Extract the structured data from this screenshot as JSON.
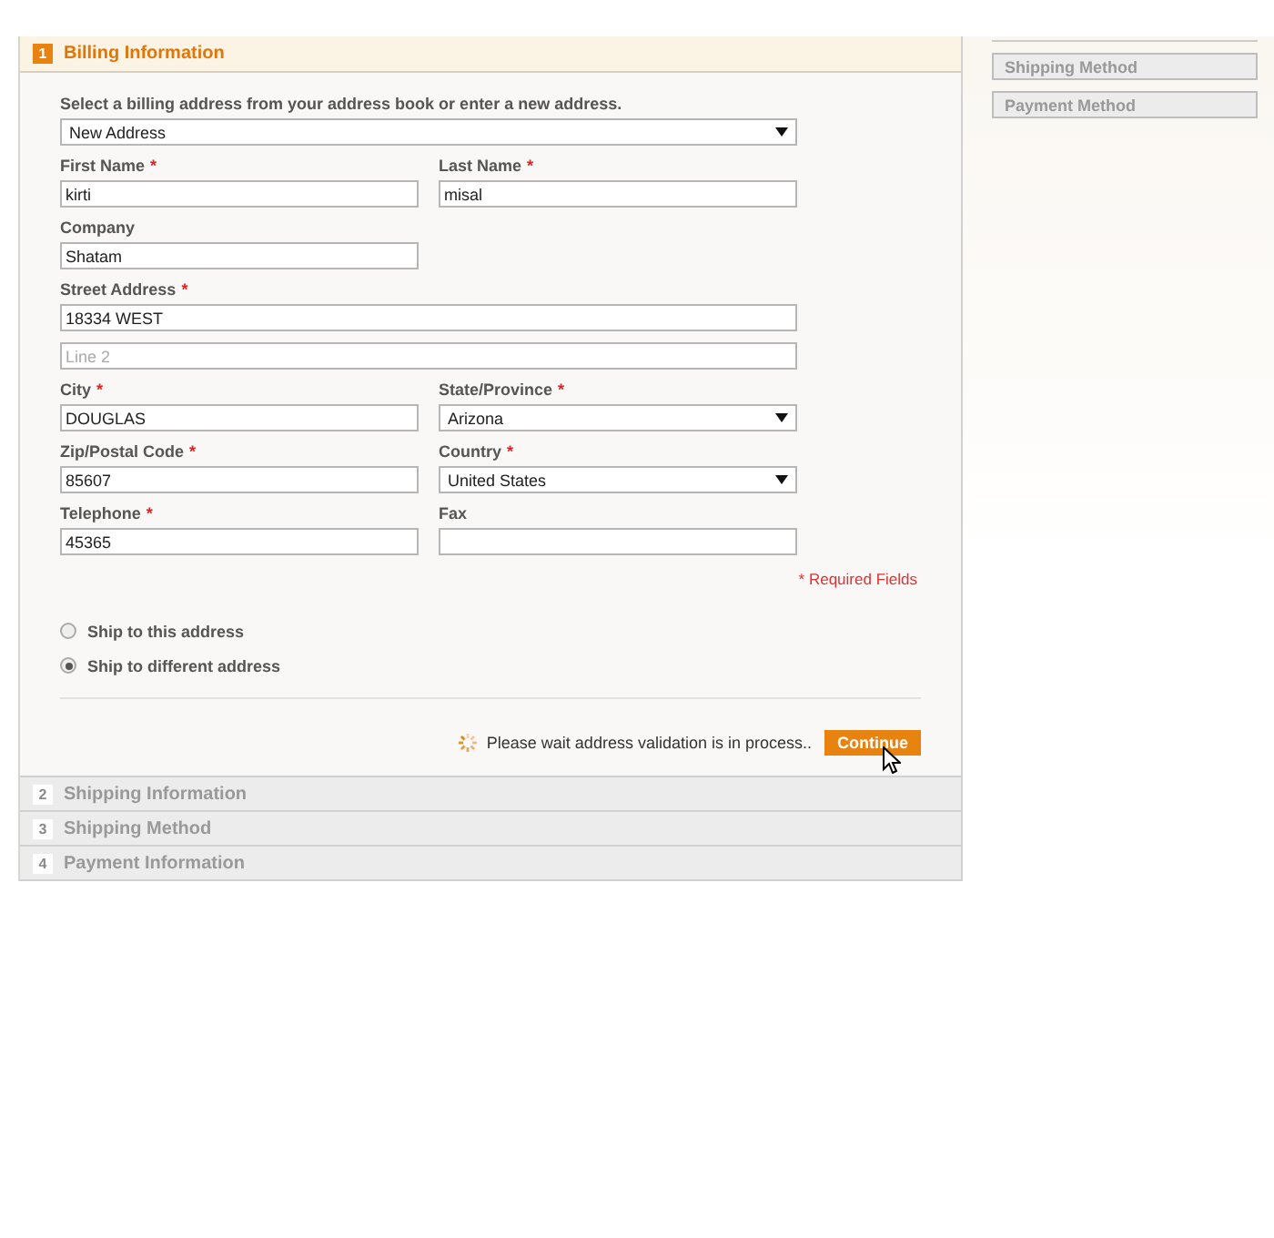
{
  "steps": [
    {
      "number": "1",
      "title": "Billing Information",
      "selected": true
    },
    {
      "number": "2",
      "title": "Shipping Information",
      "selected": false
    },
    {
      "number": "3",
      "title": "Shipping Method",
      "selected": false
    },
    {
      "number": "4",
      "title": "Payment Information",
      "selected": false
    }
  ],
  "billing": {
    "intro": "Select a billing address from your address book or enter a new address.",
    "address_select": {
      "value": "New Address"
    },
    "rows": [
      [
        {
          "label": "First Name",
          "required_mark": "*",
          "kind": "text",
          "value": "kirti",
          "wide": false
        },
        {
          "label": "Last Name",
          "required_mark": "*",
          "kind": "text",
          "value": "misal",
          "wide": false
        }
      ],
      [
        {
          "label": "Company",
          "kind": "text",
          "value": "Shatam",
          "wide": false
        }
      ],
      [
        {
          "label": "Street Address",
          "required_mark": "*",
          "kind": "text",
          "value": "18334 WEST",
          "wide": true
        }
      ],
      [
        {
          "kind": "text",
          "placeholder": "Line 2",
          "wide": true
        }
      ],
      [
        {
          "label": "City",
          "required_mark": "*",
          "kind": "text",
          "value": "DOUGLAS",
          "wide": false
        },
        {
          "label": "State/Province",
          "required_mark": "*",
          "kind": "select",
          "value": "Arizona",
          "wide": false
        }
      ],
      [
        {
          "label": "Zip/Postal Code",
          "required_mark": "*",
          "kind": "text",
          "value": "85607",
          "wide": false
        },
        {
          "label": "Country",
          "required_mark": "*",
          "kind": "select",
          "value": "United States",
          "wide": false
        }
      ],
      [
        {
          "label": "Telephone",
          "required_mark": "*",
          "kind": "text",
          "value": "45365",
          "wide": false
        },
        {
          "label": "Fax",
          "kind": "text",
          "wide": false
        }
      ]
    ],
    "required_note": "* Required Fields",
    "ship_options": [
      {
        "label": "Ship to this address",
        "selected": false
      },
      {
        "label": "Ship to different address",
        "selected": true
      }
    ],
    "wait_message": "Please wait address validation is in process..",
    "continue_button": "Continue"
  },
  "sidebar": {
    "items": [
      "Shipping Method",
      "Payment Method"
    ]
  }
}
